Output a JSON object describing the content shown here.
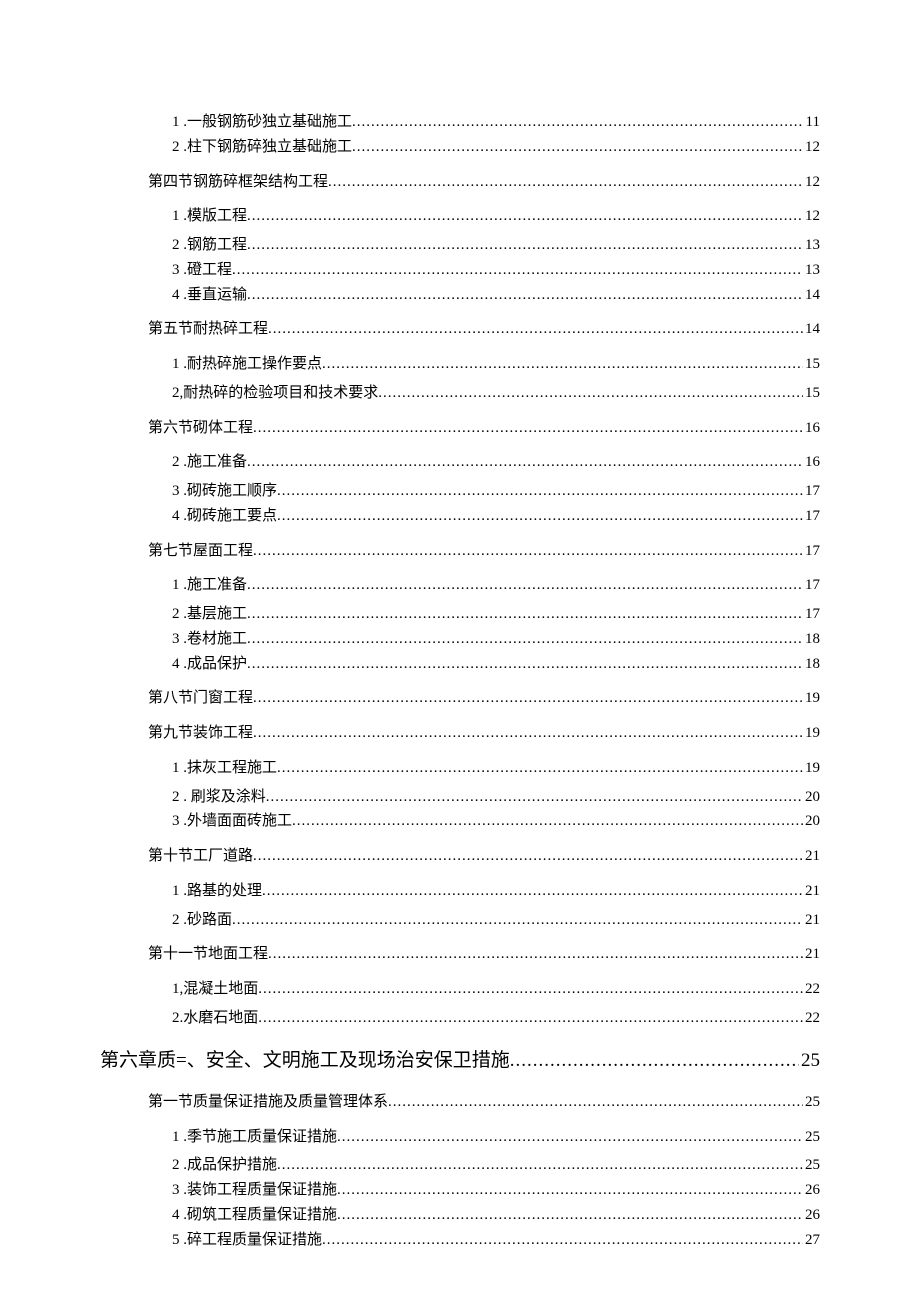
{
  "toc": [
    {
      "level": 3,
      "gap": "",
      "text": "1   .一般钢筋砂独立基础施工",
      "page": "11"
    },
    {
      "level": 3,
      "gap": "",
      "text": "2   .柱下钢筋碎独立基础施工 ",
      "page": "12"
    },
    {
      "level": 2,
      "gap": "medium",
      "text": "第四节钢筋碎框架结构工程 ",
      "page": "12"
    },
    {
      "level": 3,
      "gap": "medium",
      "text": "1   .模版工程 ",
      "page": "12"
    },
    {
      "level": 3,
      "gap": "",
      "text": "2   .钢筋工程 ",
      "page": "13"
    },
    {
      "level": 3,
      "gap": "",
      "text": "3   .磴工程 ",
      "page": "13"
    },
    {
      "level": 3,
      "gap": "",
      "text": "4   .垂直运输 ",
      "page": "14"
    },
    {
      "level": 2,
      "gap": "medium",
      "text": "第五节耐热碎工程 ",
      "page": "14"
    },
    {
      "level": 3,
      "gap": "medium",
      "text": "1   .耐热碎施工操作要点",
      "page": "15"
    },
    {
      "level": 3,
      "gap": "",
      "text": "2,耐热碎的检验项目和技术要求 ",
      "page": "15"
    },
    {
      "level": 2,
      "gap": "medium",
      "text": "第六节砌体工程 ",
      "page": "16"
    },
    {
      "level": 3,
      "gap": "medium",
      "text": "2   .施工准备",
      "page": "16"
    },
    {
      "level": 3,
      "gap": "",
      "text": "3   .砌砖施工顺序 ",
      "page": "17"
    },
    {
      "level": 3,
      "gap": "",
      "text": "4   .砌砖施工要点 ",
      "page": "17"
    },
    {
      "level": 2,
      "gap": "medium",
      "text": "第七节屋面工程 ",
      "page": "17"
    },
    {
      "level": 3,
      "gap": "medium",
      "text": "1   .施工准备",
      "page": "17"
    },
    {
      "level": 3,
      "gap": "",
      "text": "2   .基层施工",
      "page": "17"
    },
    {
      "level": 3,
      "gap": "",
      "text": "3   .卷材施工 ",
      "page": "18"
    },
    {
      "level": 3,
      "gap": "",
      "text": "4   .成品保护 ",
      "page": "18"
    },
    {
      "level": 2,
      "gap": "medium",
      "text": "第八节门窗工程 ",
      "page": "19"
    },
    {
      "level": 2,
      "gap": "medium",
      "text": "第九节装饰工程 ",
      "page": "19"
    },
    {
      "level": 3,
      "gap": "medium",
      "text": "1   .抹灰工程施工",
      "page": "19"
    },
    {
      "level": 3,
      "gap": "",
      "text": "2   . 刷浆及涂料",
      "page": "20"
    },
    {
      "level": 3,
      "gap": "",
      "text": "3   .外墙面面砖施工 ",
      "page": "20"
    },
    {
      "level": 2,
      "gap": "medium",
      "text": "第十节工厂道路 ",
      "page": "21"
    },
    {
      "level": 3,
      "gap": "medium",
      "text": "1   .路基的处理",
      "page": "21"
    },
    {
      "level": 3,
      "gap": "",
      "text": "2   .砂路面 ",
      "page": "21"
    },
    {
      "level": 2,
      "gap": "medium",
      "text": "第十一节地面工程 ",
      "page": "21"
    },
    {
      "level": 3,
      "gap": "medium",
      "text": "1,混凝土地面 ",
      "page": "22"
    },
    {
      "level": 3,
      "gap": "",
      "text": "2.水磨石地面",
      "page": "22"
    },
    {
      "level": 1,
      "gap": "large",
      "text": "第六章质=、安全、文明施工及现场治安保卫措施 ",
      "page": "25"
    },
    {
      "level": 2,
      "gap": "large",
      "text": "第一节质量保证措施及质量管理体系 ",
      "page": "25"
    },
    {
      "level": 3,
      "gap": "medium",
      "text": "1   .季节施工质量保证措施",
      "page": "25"
    },
    {
      "level": 3,
      "gap": "",
      "text": "2   .成品保护措施 ",
      "page": "25"
    },
    {
      "level": 3,
      "gap": "",
      "text": "3   .装饰工程质量保证措施 ",
      "page": "26"
    },
    {
      "level": 3,
      "gap": "",
      "text": "4   .砌筑工程质量保证措施 ",
      "page": "26"
    },
    {
      "level": 3,
      "gap": "",
      "text": "5   .碎工程质量保证措施 ",
      "page": "27"
    }
  ]
}
